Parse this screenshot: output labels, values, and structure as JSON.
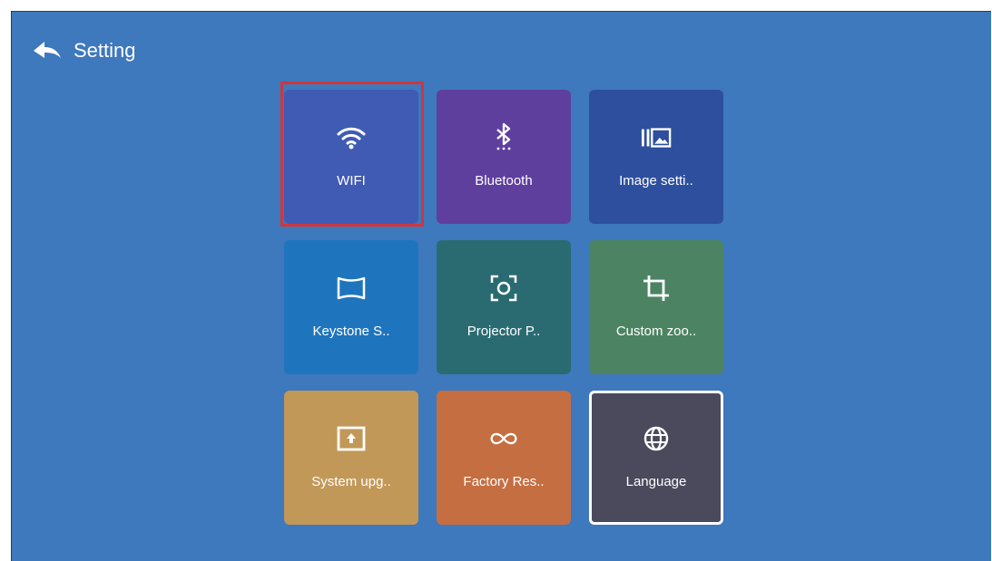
{
  "header": {
    "title": "Setting",
    "back_icon": "back-arrow-icon"
  },
  "tiles": [
    {
      "label": "WIFI",
      "icon": "wifi-icon",
      "color": "#3f5bb4"
    },
    {
      "label": "Bluetooth",
      "icon": "bluetooth-icon",
      "color": "#5f3f9e"
    },
    {
      "label": "Image setti..",
      "icon": "image-settings-icon",
      "color": "#2e4f9d"
    },
    {
      "label": "Keystone S..",
      "icon": "keystone-icon",
      "color": "#1f75bd"
    },
    {
      "label": "Projector P..",
      "icon": "projector-icon",
      "color": "#2a6b72"
    },
    {
      "label": "Custom zoo..",
      "icon": "crop-icon",
      "color": "#4c8463"
    },
    {
      "label": "System upg..",
      "icon": "system-upgrade-icon",
      "color": "#c29858"
    },
    {
      "label": "Factory Res..",
      "icon": "infinity-icon",
      "color": "#c46e42"
    },
    {
      "label": "Language",
      "icon": "globe-icon",
      "color": "#4b4a5c"
    }
  ],
  "colors": {
    "background": "#3e78bd",
    "selection_outline": "#d1363a",
    "focus_border": "#ffffff"
  }
}
